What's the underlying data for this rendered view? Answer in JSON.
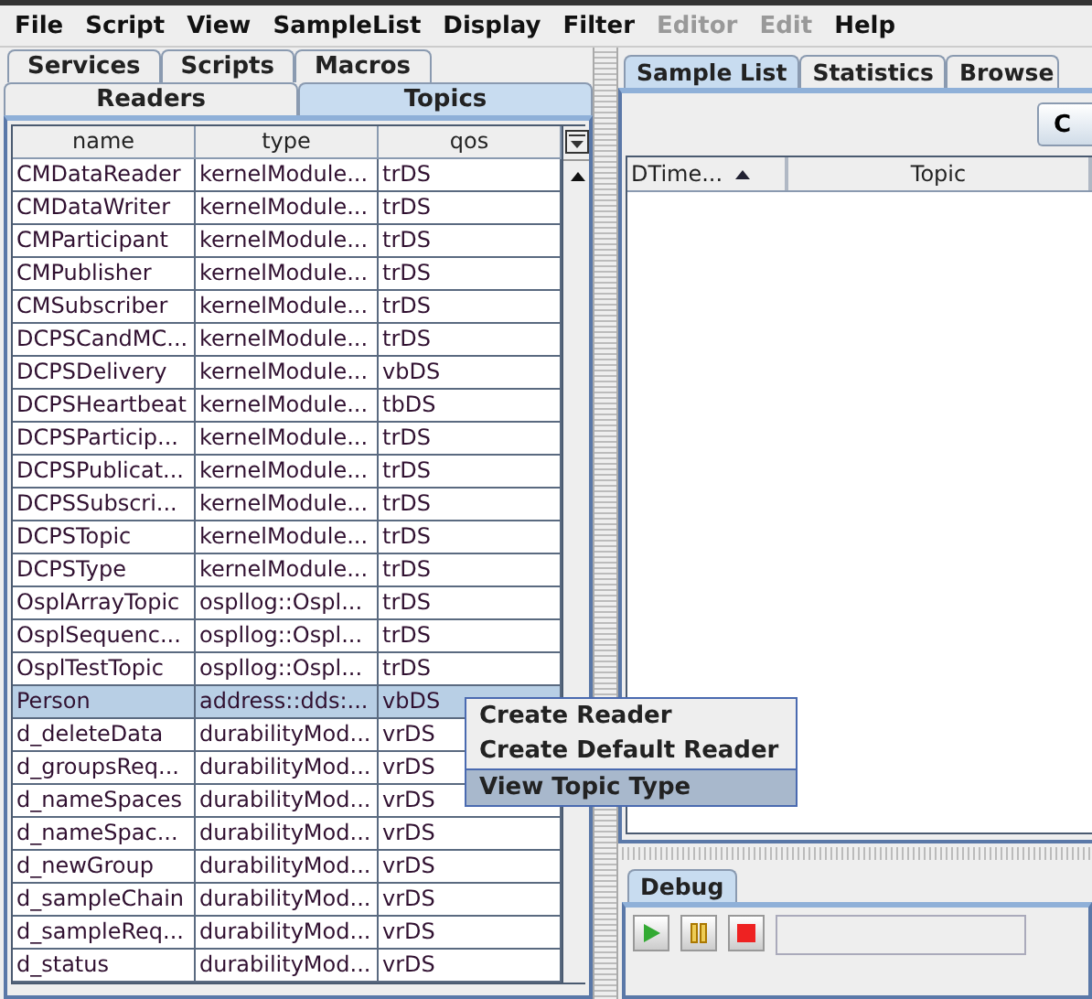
{
  "menu_bar": [
    {
      "label": "File",
      "disabled": false
    },
    {
      "label": "Script",
      "disabled": false
    },
    {
      "label": "View",
      "disabled": false
    },
    {
      "label": "SampleList",
      "disabled": false
    },
    {
      "label": "Display",
      "disabled": false
    },
    {
      "label": "Filter",
      "disabled": false
    },
    {
      "label": "Editor",
      "disabled": true
    },
    {
      "label": "Edit",
      "disabled": true
    },
    {
      "label": "Help",
      "disabled": false
    }
  ],
  "left_tabs_top": [
    {
      "label": "Services",
      "selected": false
    },
    {
      "label": "Scripts",
      "selected": false
    },
    {
      "label": "Macros",
      "selected": false
    }
  ],
  "left_tabs": [
    {
      "label": "Readers",
      "selected": false
    },
    {
      "label": "Topics",
      "selected": true
    }
  ],
  "topics_table": {
    "columns": [
      "name",
      "type",
      "qos"
    ],
    "rows": [
      {
        "name": "CMDataReader",
        "type": "kernelModule...",
        "qos": "trDS",
        "selected": false
      },
      {
        "name": "CMDataWriter",
        "type": "kernelModule...",
        "qos": "trDS",
        "selected": false
      },
      {
        "name": "CMParticipant",
        "type": "kernelModule...",
        "qos": "trDS",
        "selected": false
      },
      {
        "name": "CMPublisher",
        "type": "kernelModule...",
        "qos": "trDS",
        "selected": false
      },
      {
        "name": "CMSubscriber",
        "type": "kernelModule...",
        "qos": "trDS",
        "selected": false
      },
      {
        "name": "DCPSCandMC...",
        "type": "kernelModule...",
        "qos": "trDS",
        "selected": false
      },
      {
        "name": "DCPSDelivery",
        "type": "kernelModule...",
        "qos": "vbDS",
        "selected": false
      },
      {
        "name": "DCPSHeartbeat",
        "type": "kernelModule...",
        "qos": "tbDS",
        "selected": false
      },
      {
        "name": "DCPSParticip...",
        "type": "kernelModule...",
        "qos": "trDS",
        "selected": false
      },
      {
        "name": "DCPSPublicat...",
        "type": "kernelModule...",
        "qos": "trDS",
        "selected": false
      },
      {
        "name": "DCPSSubscri...",
        "type": "kernelModule...",
        "qos": "trDS",
        "selected": false
      },
      {
        "name": "DCPSTopic",
        "type": "kernelModule...",
        "qos": "trDS",
        "selected": false
      },
      {
        "name": "DCPSType",
        "type": "kernelModule...",
        "qos": "trDS",
        "selected": false
      },
      {
        "name": "OsplArrayTopic",
        "type": "ospllog::Ospl...",
        "qos": "trDS",
        "selected": false
      },
      {
        "name": "OsplSequenc...",
        "type": "ospllog::Ospl...",
        "qos": "trDS",
        "selected": false
      },
      {
        "name": "OsplTestTopic",
        "type": "ospllog::Ospl...",
        "qos": "trDS",
        "selected": false
      },
      {
        "name": "Person",
        "type": "address::dds:...",
        "qos": "vbDS",
        "selected": true
      },
      {
        "name": "d_deleteData",
        "type": "durabilityMod...",
        "qos": "vrDS",
        "selected": false
      },
      {
        "name": "d_groupsReq...",
        "type": "durabilityMod...",
        "qos": "vrDS",
        "selected": false
      },
      {
        "name": "d_nameSpaces",
        "type": "durabilityMod...",
        "qos": "vrDS",
        "selected": false
      },
      {
        "name": "d_nameSpac...",
        "type": "durabilityMod...",
        "qos": "vrDS",
        "selected": false
      },
      {
        "name": "d_newGroup",
        "type": "durabilityMod...",
        "qos": "vrDS",
        "selected": false
      },
      {
        "name": "d_sampleChain",
        "type": "durabilityMod...",
        "qos": "vrDS",
        "selected": false
      },
      {
        "name": "d_sampleReq...",
        "type": "durabilityMod...",
        "qos": "vrDS",
        "selected": false
      },
      {
        "name": "d_status",
        "type": "durabilityMod...",
        "qos": "vrDS",
        "selected": false
      }
    ]
  },
  "right_tabs": [
    {
      "label": "Sample List",
      "selected": true
    },
    {
      "label": "Statistics",
      "selected": false
    },
    {
      "label": "Browse",
      "selected": false
    }
  ],
  "right_button": {
    "label": "C"
  },
  "sample_table": {
    "columns": [
      {
        "label": "DTime...",
        "sorted": true
      },
      {
        "label": "Topic",
        "sorted": false
      }
    ]
  },
  "context_menu": [
    {
      "label": "Create Reader",
      "selected": false
    },
    {
      "label": "Create Default Reader",
      "selected": false
    },
    {
      "label": "View Topic Type",
      "selected": true
    }
  ],
  "debug_tabs": [
    {
      "label": "Debug",
      "selected": true
    }
  ]
}
